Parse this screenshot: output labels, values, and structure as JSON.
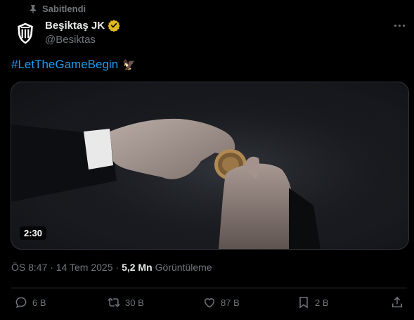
{
  "pinned": {
    "label": "Sabitlendi",
    "icon": "pin-icon"
  },
  "author": {
    "display_name": "Beşiktaş JK",
    "handle": "@Besiktas",
    "verified": true,
    "verified_color": "#e2b719"
  },
  "tweet": {
    "hashtag": "#LetTheGameBegin",
    "emoji": "🦅"
  },
  "media": {
    "duration": "2:30"
  },
  "meta": {
    "timestamp": "ÖS 8:47 · 14 Tem 2025 ·",
    "views_count": "5,2 Mn",
    "views_label": "Görüntüleme"
  },
  "actions": {
    "reply": "6 B",
    "retweet": "30 B",
    "like": "87 B",
    "bookmark": "2 B"
  },
  "colors": {
    "accent": "#1d9bf0",
    "muted": "#71767b",
    "text": "#e7e9ea",
    "background": "#000000"
  }
}
